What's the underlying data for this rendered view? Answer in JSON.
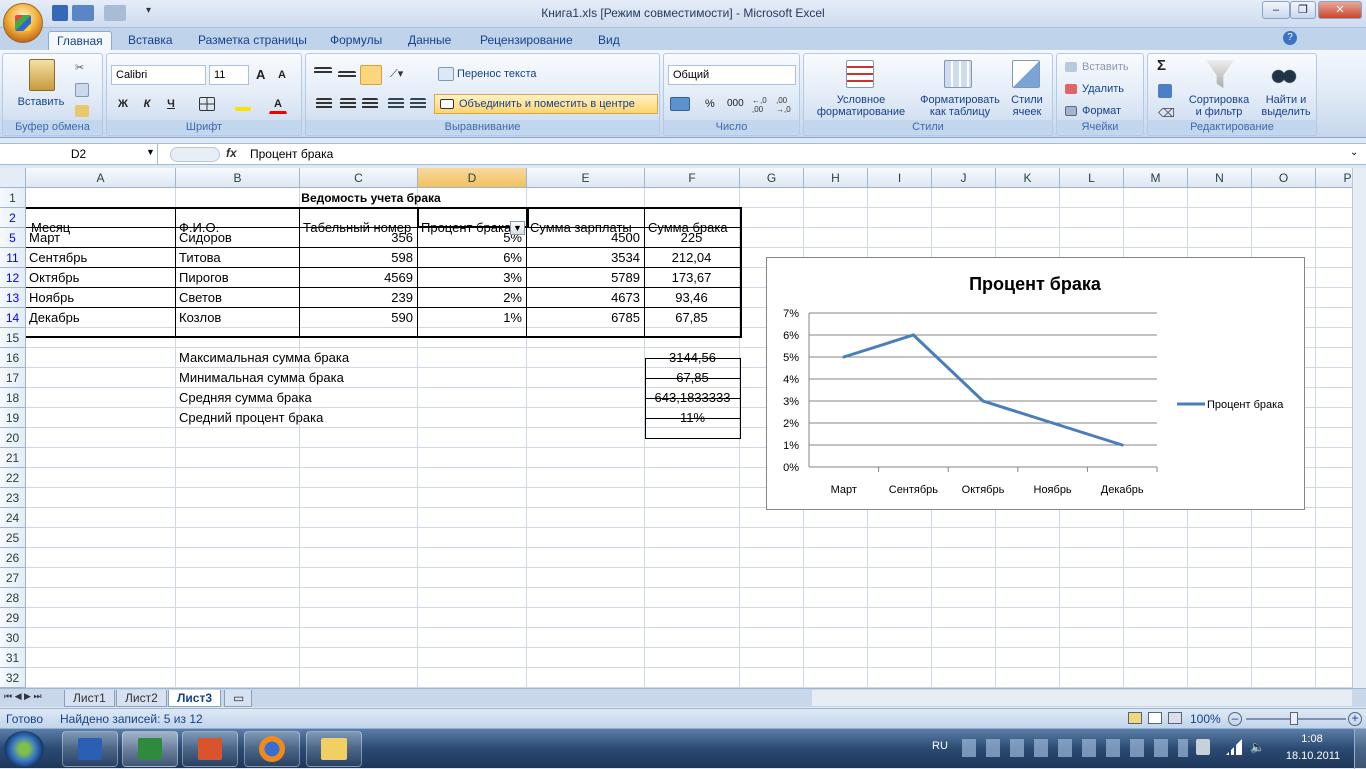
{
  "window": {
    "title": "Книга1.xls  [Режим совместимости] - Microsoft Excel",
    "minimize": "–",
    "restore": "❐",
    "close": "✕"
  },
  "tabs": [
    "Главная",
    "Вставка",
    "Разметка страницы",
    "Формулы",
    "Данные",
    "Рецензирование",
    "Вид"
  ],
  "ribbon": {
    "clipboard": {
      "title": "Буфер обмена",
      "paste": "Вставить"
    },
    "font": {
      "title": "Шрифт",
      "name": "Calibri",
      "size": "11",
      "bold": "Ж",
      "italic": "К",
      "underline": "Ч",
      "grow": "A",
      "shrink": "A",
      "color_letter": "A"
    },
    "alignment": {
      "title": "Выравнивание",
      "wrap": "Перенос текста",
      "merge": "Объединить и поместить в центре"
    },
    "number": {
      "title": "Число",
      "format": "Общий",
      "percent": "%",
      "thousands": "000"
    },
    "styles": {
      "title": "Стили",
      "conditional_1": "Условное",
      "conditional_2": "форматирование",
      "table_1": "Форматировать",
      "table_2": "как таблицу",
      "cell_1": "Стили",
      "cell_2": "ячеек"
    },
    "cells": {
      "title": "Ячейки",
      "insert": "Вставить",
      "delete": "Удалить",
      "format": "Формат"
    },
    "editing": {
      "title": "Редактирование",
      "sort_1": "Сортировка",
      "sort_2": "и фильтр",
      "find_1": "Найти и",
      "find_2": "выделить",
      "sigma": "Σ"
    }
  },
  "formula_bar": {
    "name_box": "D2",
    "fx": "fx",
    "content": "Процент брака"
  },
  "columns": [
    "A",
    "B",
    "C",
    "D",
    "E",
    "F",
    "G",
    "H",
    "I",
    "J",
    "K",
    "L",
    "M",
    "N",
    "O",
    "P"
  ],
  "rows": [
    "1",
    "2",
    "5",
    "11",
    "12",
    "13",
    "14",
    "15",
    "16",
    "17",
    "18",
    "19",
    "20",
    "21",
    "22",
    "23",
    "24",
    "25",
    "26",
    "27",
    "28",
    "29",
    "30",
    "31",
    "32"
  ],
  "sheet": {
    "title": "Ведомость учета брака",
    "headers": [
      "Месяц",
      "Ф.И.О.",
      "Табельный номер",
      "Процент брака",
      "Сумма зарплаты",
      "Сумма брака"
    ],
    "data": [
      [
        "Март",
        "Сидоров",
        "356",
        "5%",
        "4500",
        "225"
      ],
      [
        "Сентябрь",
        "Титова",
        "598",
        "6%",
        "3534",
        "212,04"
      ],
      [
        "Октябрь",
        "Пирогов",
        "4569",
        "3%",
        "5789",
        "173,67"
      ],
      [
        "Ноябрь",
        "Светов",
        "239",
        "2%",
        "4673",
        "93,46"
      ],
      [
        "Декабрь",
        "Козлов",
        "590",
        "1%",
        "6785",
        "67,85"
      ]
    ],
    "stats": [
      [
        "Максимальная сумма брака",
        "3144,56"
      ],
      [
        "Минимальная сумма брака",
        "67,85"
      ],
      [
        "Средняя сумма брака",
        "643,1833333"
      ],
      [
        "Средний процент брака",
        "11%"
      ]
    ]
  },
  "chart_data": {
    "type": "line",
    "title": "Процент брака",
    "categories": [
      "Март",
      "Сентябрь",
      "Октябрь",
      "Ноябрь",
      "Декабрь"
    ],
    "series": [
      {
        "name": "Процент брака",
        "values": [
          5,
          6,
          3,
          2,
          1
        ],
        "color": "#4a7ebb"
      }
    ],
    "y_ticks": [
      "0%",
      "1%",
      "2%",
      "3%",
      "4%",
      "5%",
      "6%",
      "7%"
    ],
    "ylim": [
      0,
      7
    ],
    "grid": true,
    "legend": "right"
  },
  "sheet_tabs": [
    "Лист1",
    "Лист2",
    "Лист3"
  ],
  "status": {
    "ready": "Готово",
    "found": "Найдено записей: 5 из 12",
    "zoom": "100%"
  },
  "taskbar": {
    "lang": "RU",
    "time": "1:08",
    "date": "18.10.2011"
  }
}
